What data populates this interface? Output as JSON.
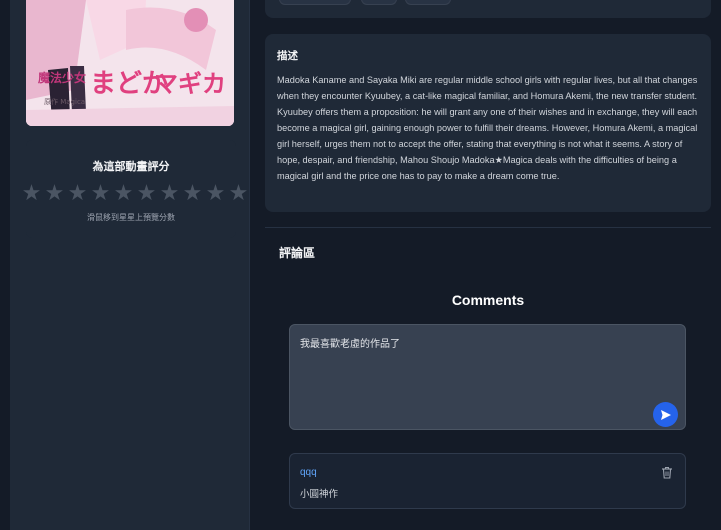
{
  "sidebar": {
    "cover_alt": "Puella Magi Madoka Magica cover",
    "rating": {
      "title": "為這部動畫評分",
      "stars": 10,
      "value": 0,
      "hint": "滑鼠移到星星上預覽分數",
      "star_color": "#4b5563"
    }
  },
  "description": {
    "title": "描述",
    "text": "Madoka Kaname and Sayaka Miki are regular middle school girls with regular lives, but all that changes when they encounter Kyuubey, a cat-like magical familiar, and Homura Akemi, the new transfer student. Kyuubey offers them a proposition: he will grant any one of their wishes and in exchange, they will each become a magical girl, gaining enough power to fulfill their dreams. However, Homura Akemi, a magical girl herself, urges them not to accept the offer, stating that everything is not what it seems. A story of hope, despair, and friendship, Mahou Shoujo Madoka★Magica deals with the difficulties of being a magical girl and the price one has to pay to make a dream come true."
  },
  "comments_section": {
    "zone_title": "評論區",
    "heading": "Comments",
    "input_value": "我最喜歡老虛的作品了",
    "send_icon": "send-icon",
    "accent": "#2563eb",
    "comments": [
      {
        "user": "qqq",
        "text": "小圓神作",
        "icon": "trash-icon"
      }
    ]
  }
}
